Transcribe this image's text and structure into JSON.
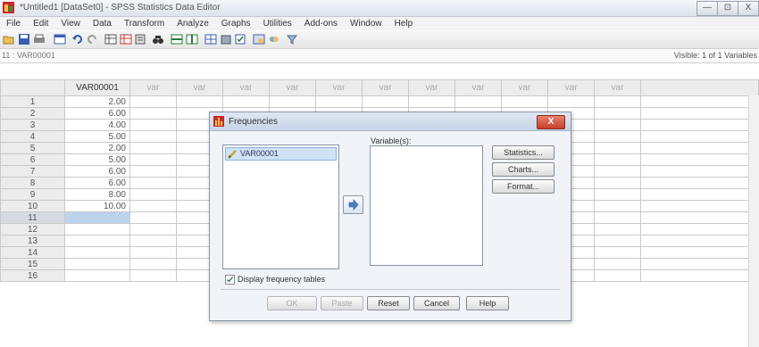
{
  "window": {
    "title": "*Untitled1 [DataSet0] - SPSS Statistics Data Editor",
    "controls": [
      "—",
      "⊡",
      "X"
    ]
  },
  "menu": [
    "File",
    "Edit",
    "View",
    "Data",
    "Transform",
    "Analyze",
    "Graphs",
    "Utilities",
    "Add-ons",
    "Window",
    "Help"
  ],
  "toolbar_icons": [
    "open-icon",
    "save-icon",
    "print-icon",
    "dialog-recall-icon",
    "undo-icon",
    "redo-icon",
    "goto-case-icon",
    "goto-variable-icon",
    "variables-icon",
    "find-icon",
    "insert-cases-icon",
    "insert-variable-icon",
    "split-file-icon",
    "weight-cases-icon",
    "select-cases-icon",
    "value-labels-icon",
    "use-sets-icon",
    "show-all-variables-icon"
  ],
  "cellbar": {
    "cell_ref": "11 : VAR00001",
    "visible": "Visible: 1 of 1 Variables"
  },
  "grid": {
    "headers": [
      "VAR00001",
      "var",
      "var",
      "var",
      "var",
      "var",
      "var",
      "var",
      "var",
      "var",
      "var",
      "var"
    ],
    "rows": [
      {
        "n": "1",
        "v": "2.00"
      },
      {
        "n": "2",
        "v": "6.00"
      },
      {
        "n": "3",
        "v": "4.00"
      },
      {
        "n": "4",
        "v": "5.00"
      },
      {
        "n": "5",
        "v": "2.00"
      },
      {
        "n": "6",
        "v": "5.00"
      },
      {
        "n": "7",
        "v": "6.00"
      },
      {
        "n": "8",
        "v": "6.00"
      },
      {
        "n": "9",
        "v": "8.00"
      },
      {
        "n": "10",
        "v": "10.00"
      },
      {
        "n": "11",
        "v": ""
      },
      {
        "n": "12",
        "v": ""
      },
      {
        "n": "13",
        "v": ""
      },
      {
        "n": "14",
        "v": ""
      },
      {
        "n": "15",
        "v": ""
      },
      {
        "n": "16",
        "v": ""
      }
    ]
  },
  "dialog": {
    "title": "Frequencies",
    "close": "X",
    "source_item": "VAR00001",
    "variables_label": "Variable(s):",
    "side_buttons": [
      "Statistics...",
      "Charts...",
      "Format..."
    ],
    "checkbox_label": "Display frequency tables",
    "checkbox_checked": true,
    "bottom_buttons": [
      {
        "label": "OK",
        "disabled": true
      },
      {
        "label": "Paste",
        "disabled": true
      },
      {
        "label": "Reset",
        "disabled": false
      },
      {
        "label": "Cancel",
        "disabled": false
      },
      {
        "label": "Help",
        "disabled": false
      }
    ]
  }
}
